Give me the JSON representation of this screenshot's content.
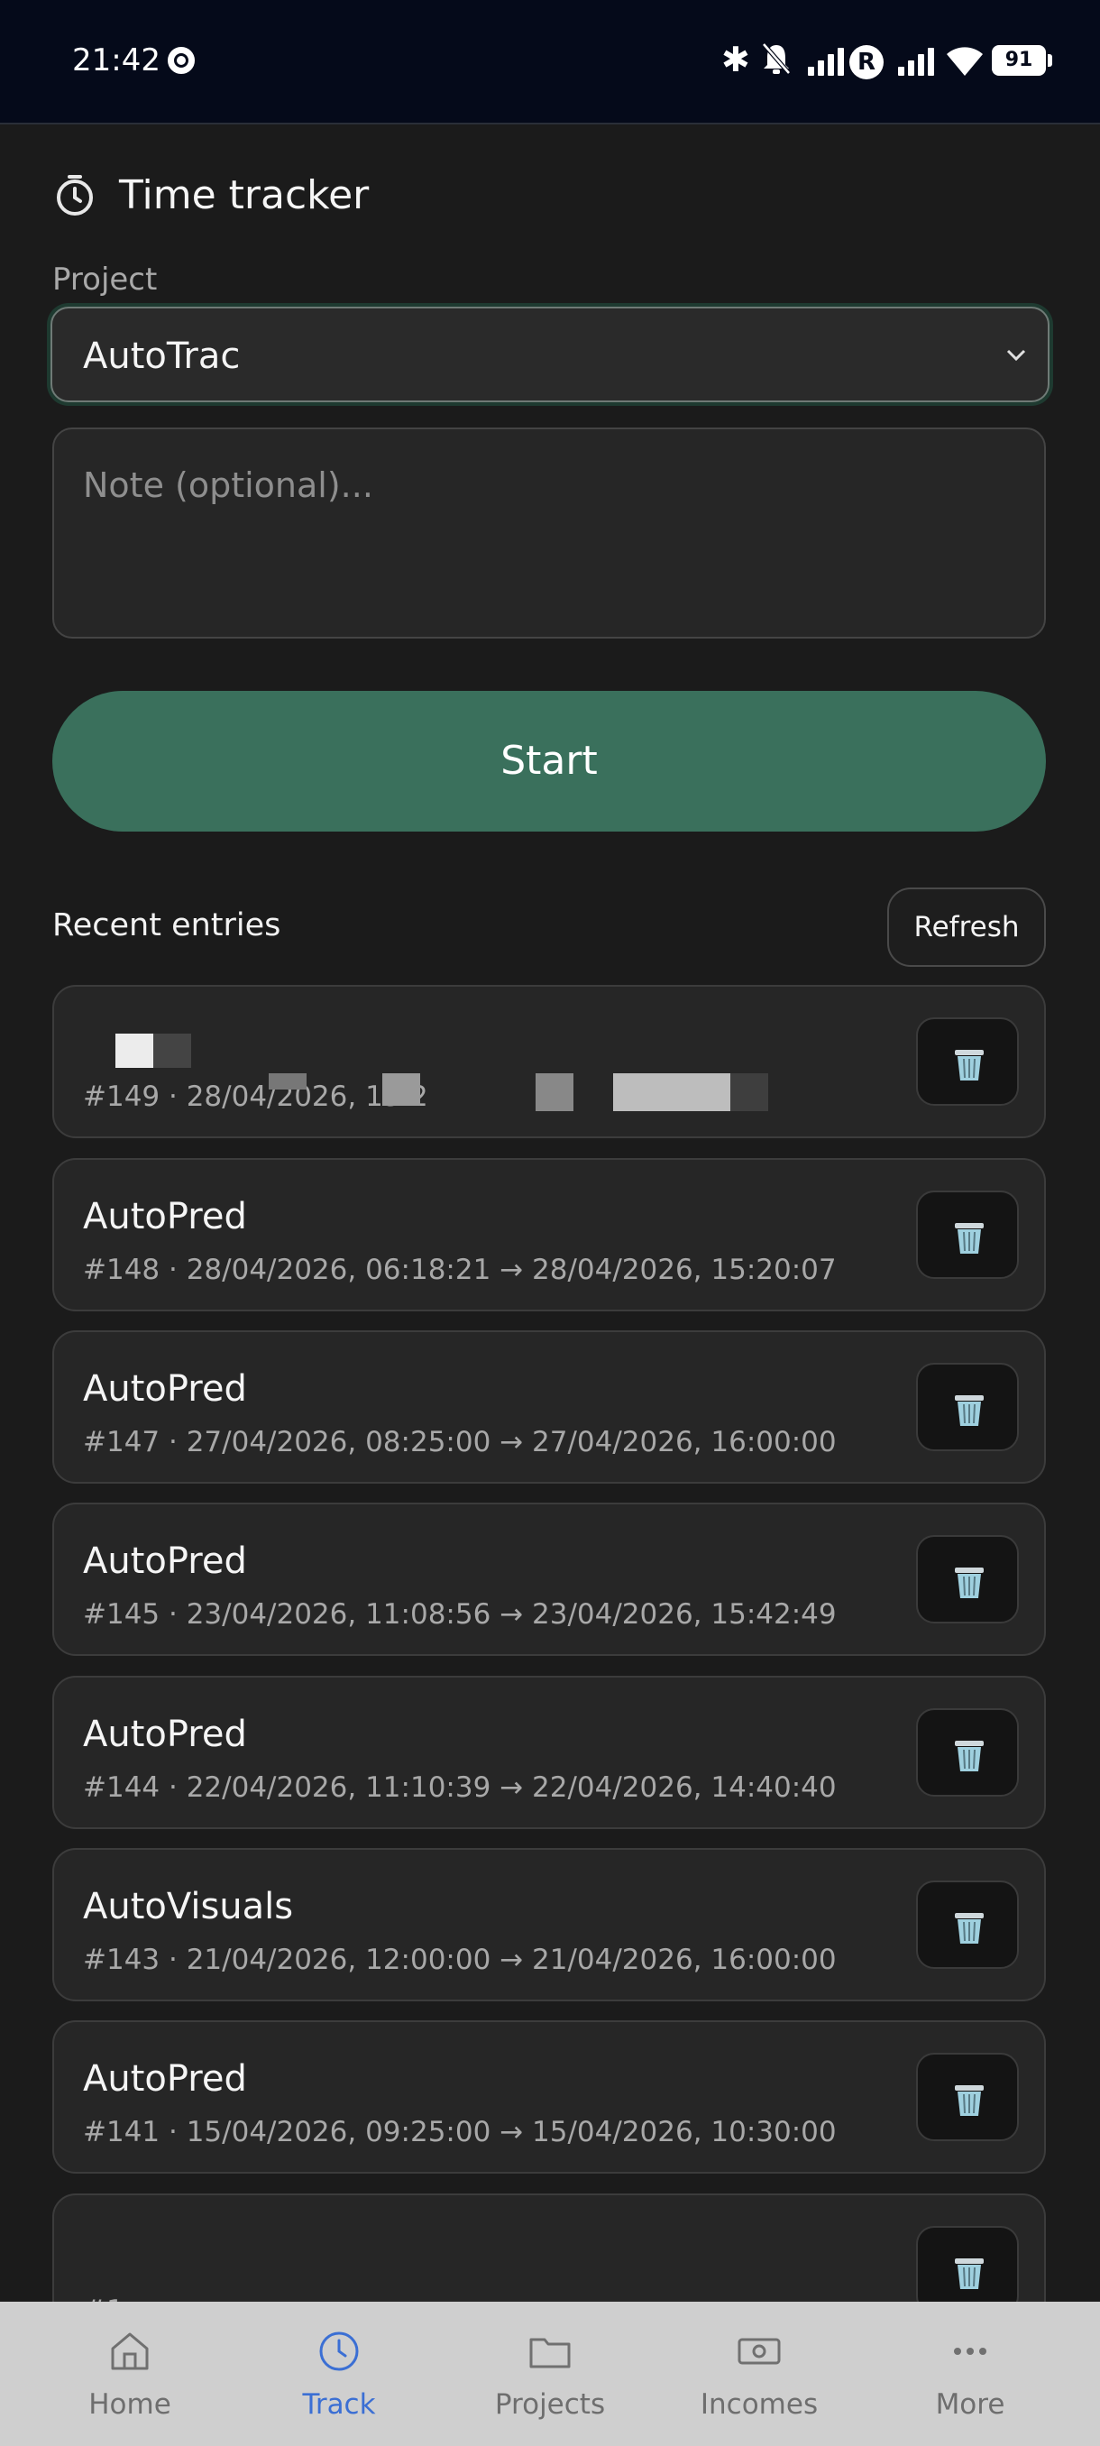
{
  "status_bar": {
    "time": "21:42",
    "battery": "91"
  },
  "header": {
    "title": "Time tracker"
  },
  "project": {
    "label": "Project",
    "selected": "AutoTrac"
  },
  "note": {
    "placeholder": "Note (optional)..."
  },
  "start_button": {
    "label": "Start"
  },
  "recent": {
    "title": "Recent entries",
    "refresh_label": "Refresh",
    "entries": [
      {
        "title": "",
        "meta": "#149 · 28/04/2026, 15:2"
      },
      {
        "title": "AutoPred",
        "meta": "#148 · 28/04/2026, 06:18:21 → 28/04/2026, 15:20:07"
      },
      {
        "title": "AutoPred",
        "meta": "#147 · 27/04/2026, 08:25:00 → 27/04/2026, 16:00:00"
      },
      {
        "title": "AutoPred",
        "meta": "#145 · 23/04/2026, 11:08:56 → 23/04/2026, 15:42:49"
      },
      {
        "title": "AutoPred",
        "meta": "#144 · 22/04/2026, 11:10:39 → 22/04/2026, 14:40:40"
      },
      {
        "title": "AutoVisuals",
        "meta": "#143 · 21/04/2026, 12:00:00 → 21/04/2026, 16:00:00"
      },
      {
        "title": "AutoPred",
        "meta": "#141 · 15/04/2026, 09:25:00 → 15/04/2026, 10:30:00"
      },
      {
        "title": "",
        "meta": "#1"
      }
    ]
  },
  "nav": {
    "items": [
      {
        "label": "Home",
        "icon": "home-icon"
      },
      {
        "label": "Track",
        "icon": "clock-icon"
      },
      {
        "label": "Projects",
        "icon": "folder-icon"
      },
      {
        "label": "Incomes",
        "icon": "banknote-icon"
      },
      {
        "label": "More",
        "icon": "more-icon"
      }
    ],
    "active": "Track",
    "active_color": "#3b6fd4"
  },
  "colors": {
    "accent": "#3a705c",
    "background": "#1b1b1b",
    "card": "#262626"
  }
}
